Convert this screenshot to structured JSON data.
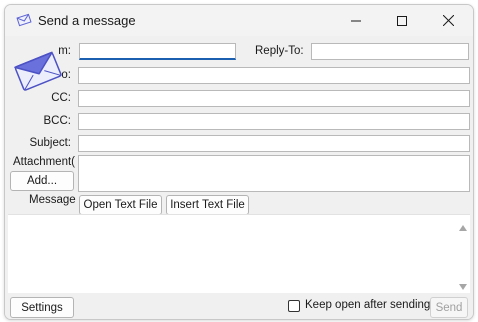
{
  "window": {
    "title": "Send a message"
  },
  "form": {
    "from_label": "m:",
    "reply_to_label": "Reply-To:",
    "to_label": "o:",
    "cc_label": "CC:",
    "bcc_label": "BCC:",
    "subject_label": "Subject:",
    "attachment_label": "Attachment(",
    "add_button": "Add...",
    "message_label": "Message",
    "open_text_file_button": "Open Text File",
    "insert_text_file_button": "Insert Text File"
  },
  "footer": {
    "settings_button": "Settings",
    "keep_open_label": "Keep open after sending",
    "keep_open_checked": false,
    "send_button": "Send"
  },
  "icons": [
    "envelope-icon",
    "minimize-icon",
    "maximize-icon",
    "close-icon",
    "scroll-up-icon",
    "scroll-down-icon"
  ],
  "colors": {
    "accent": "#1b5fb0",
    "envelope": "#5d63d4"
  }
}
